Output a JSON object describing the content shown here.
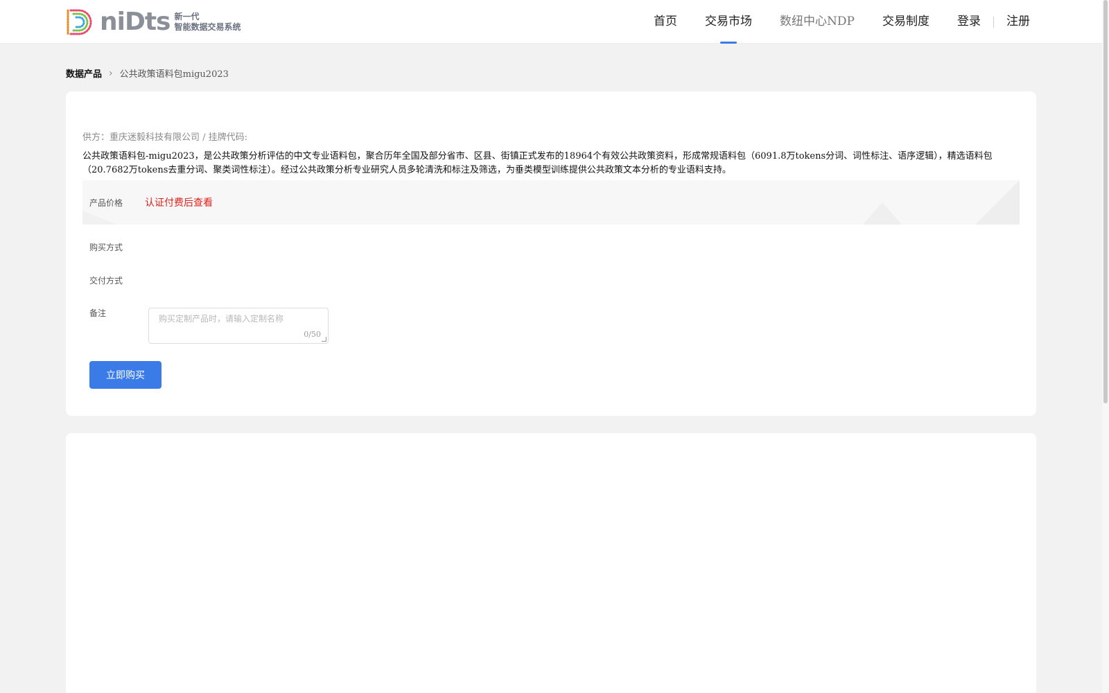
{
  "brand": {
    "logo_text": "niDts",
    "tagline_1": "新一代",
    "tagline_2": "智能数据交易系统"
  },
  "nav": {
    "items": [
      {
        "label": "首页",
        "active": false
      },
      {
        "label": "交易市场",
        "active": true
      },
      {
        "label": "数纽中心NDP",
        "active": false
      },
      {
        "label": "交易制度",
        "active": false
      }
    ],
    "login": "登录",
    "register": "注册",
    "accent_color": "#3b7be8"
  },
  "breadcrumb": {
    "root": "数据产品",
    "current": "公共政策语料包migu2023"
  },
  "product": {
    "supplier_line": "供方：重庆迷毅科技有限公司 / 挂牌代码:",
    "description": "公共政策语料包-migu2023，是公共政策分析评估的中文专业语料包，聚合历年全国及部分省市、区县、街镇正式发布的18964个有效公共政策资料，形成常规语料包（6091.8万tokens分词、词性标注、语序逻辑），精选语料包（20.7682万tokens去重分词、聚类词性标注）。经过公共政策分析专业研究人员多轮清洗和标注及筛选，为垂类模型训练提供公共政策文本分析的专业语料支持。",
    "price_label": "产品价格",
    "price_value": "认证付费后查看",
    "price_color": "#e0211b",
    "purchase_label": "购买方式",
    "delivery_label": "交付方式",
    "remark_label": "备注",
    "remark_placeholder": "购买定制产品时，请输入定制名称",
    "remark_counter": "0/50",
    "buy_button": "立即购买"
  }
}
